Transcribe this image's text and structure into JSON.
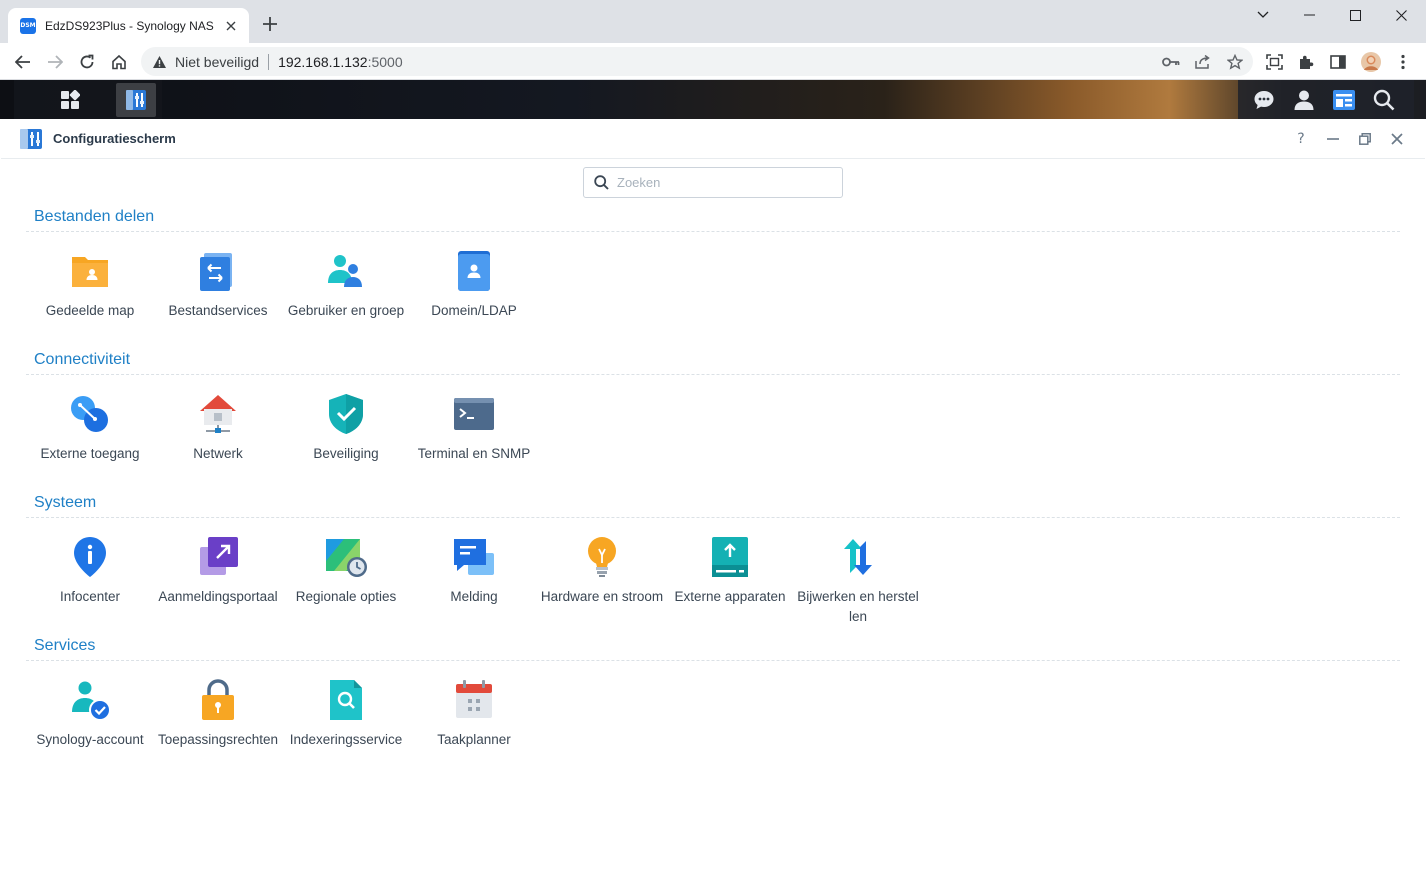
{
  "browser": {
    "tab_title": "EdzDS923Plus - Synology NAS",
    "favicon_text": "DSM",
    "insecure_label": "Niet beveiligd",
    "url_host": "192.168.1.132",
    "url_port": ":5000"
  },
  "window": {
    "title": "Configuratiescherm",
    "help": "?"
  },
  "search": {
    "placeholder": "Zoeken"
  },
  "sections": [
    {
      "title": "Bestanden delen",
      "items": [
        "Gedeelde map",
        "Bestandservices",
        "Gebruiker en groep",
        "Domein/LDAP"
      ]
    },
    {
      "title": "Connectiviteit",
      "items": [
        "Externe toegang",
        "Netwerk",
        "Beveiliging",
        "Terminal en SNMP"
      ]
    },
    {
      "title": "Systeem",
      "items": [
        "Infocenter",
        "Aanmeldingsportaal",
        "Regionale opties",
        "Melding",
        "Hardware en stroom",
        "Externe apparaten",
        "Bijwerken en herstellen"
      ]
    },
    {
      "title": "Services",
      "items": [
        "Synology-account",
        "Toepassingsrechten",
        "Indexeringsservice",
        "Taakplanner"
      ]
    }
  ],
  "colors": {
    "accent": "#1f80c6",
    "section_line": "#dbe1e6"
  }
}
